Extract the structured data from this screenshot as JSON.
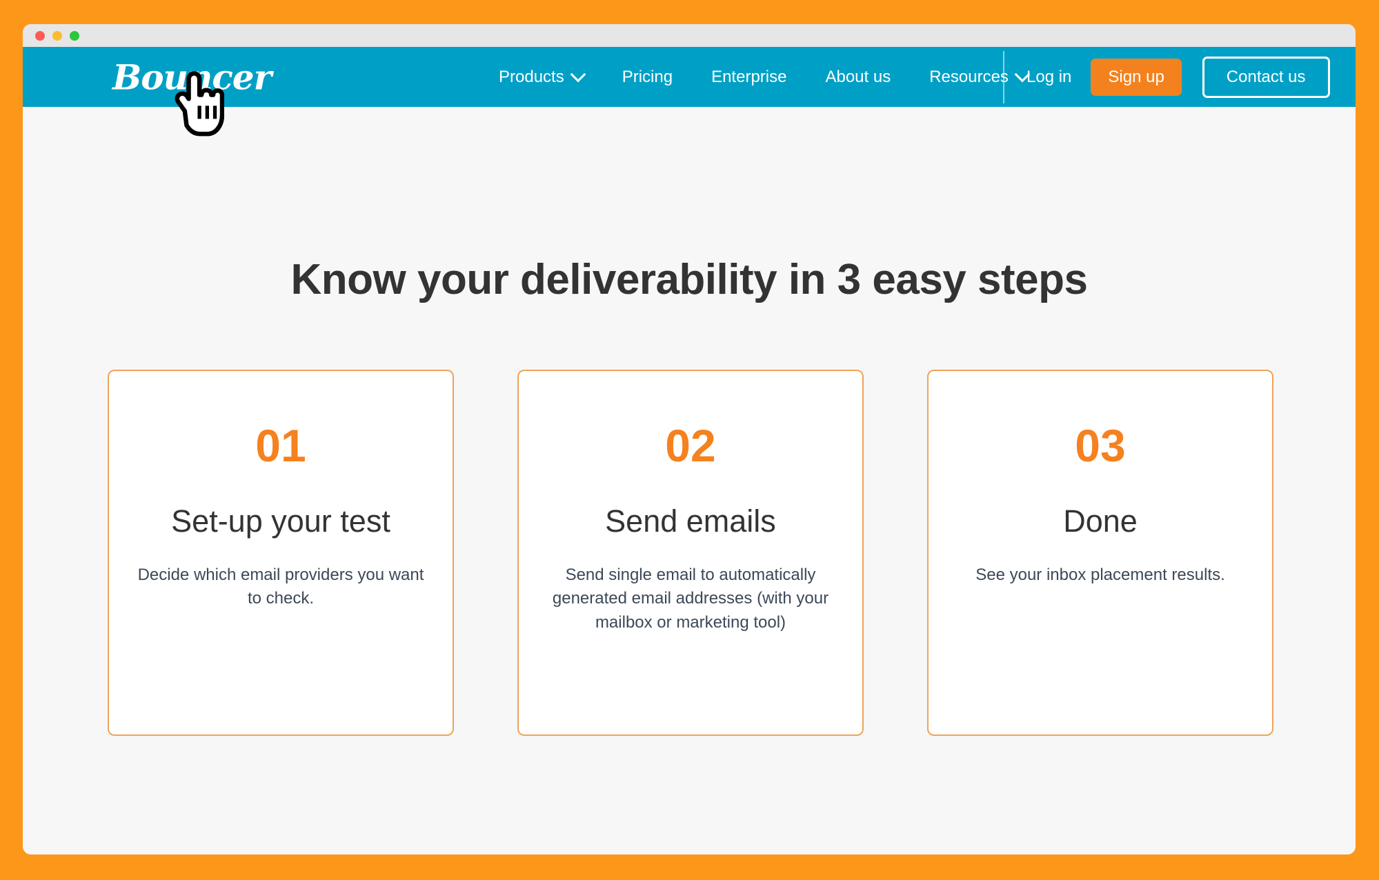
{
  "window": {
    "traffic_lights": [
      {
        "name": "close",
        "color": "#FB5C57"
      },
      {
        "name": "minimize",
        "color": "#FBBD2E"
      },
      {
        "name": "maximize",
        "color": "#2AC73E"
      }
    ]
  },
  "theme": {
    "frame_orange": "#FC9719",
    "nav_teal": "#00A0C6",
    "accent_orange": "#F5811F",
    "button_orange": "#F3821E",
    "card_border": "#F0A355",
    "page_background": "#F7F7F8",
    "heading_color": "#333333",
    "body_text_color": "#3C4858"
  },
  "nav": {
    "logo": "Bouncer",
    "links": [
      {
        "label": "Products",
        "has_dropdown": true
      },
      {
        "label": "Pricing",
        "has_dropdown": false
      },
      {
        "label": "Enterprise",
        "has_dropdown": false
      },
      {
        "label": "About us",
        "has_dropdown": false
      },
      {
        "label": "Resources",
        "has_dropdown": true
      }
    ],
    "login_label": "Log in",
    "signup_label": "Sign up",
    "contact_label": "Contact us"
  },
  "main": {
    "heading": "Know your deliverability in 3 easy steps",
    "cards": [
      {
        "number": "01",
        "title": "Set-up your test",
        "description": "Decide which email providers you want to check."
      },
      {
        "number": "02",
        "title": "Send emails",
        "description": "Send single email to automatically generated email addresses (with your mailbox or marketing tool)"
      },
      {
        "number": "03",
        "title": "Done",
        "description": "See your inbox placement results."
      }
    ]
  },
  "cursor": {
    "icon": "pointing-hand-cursor"
  }
}
